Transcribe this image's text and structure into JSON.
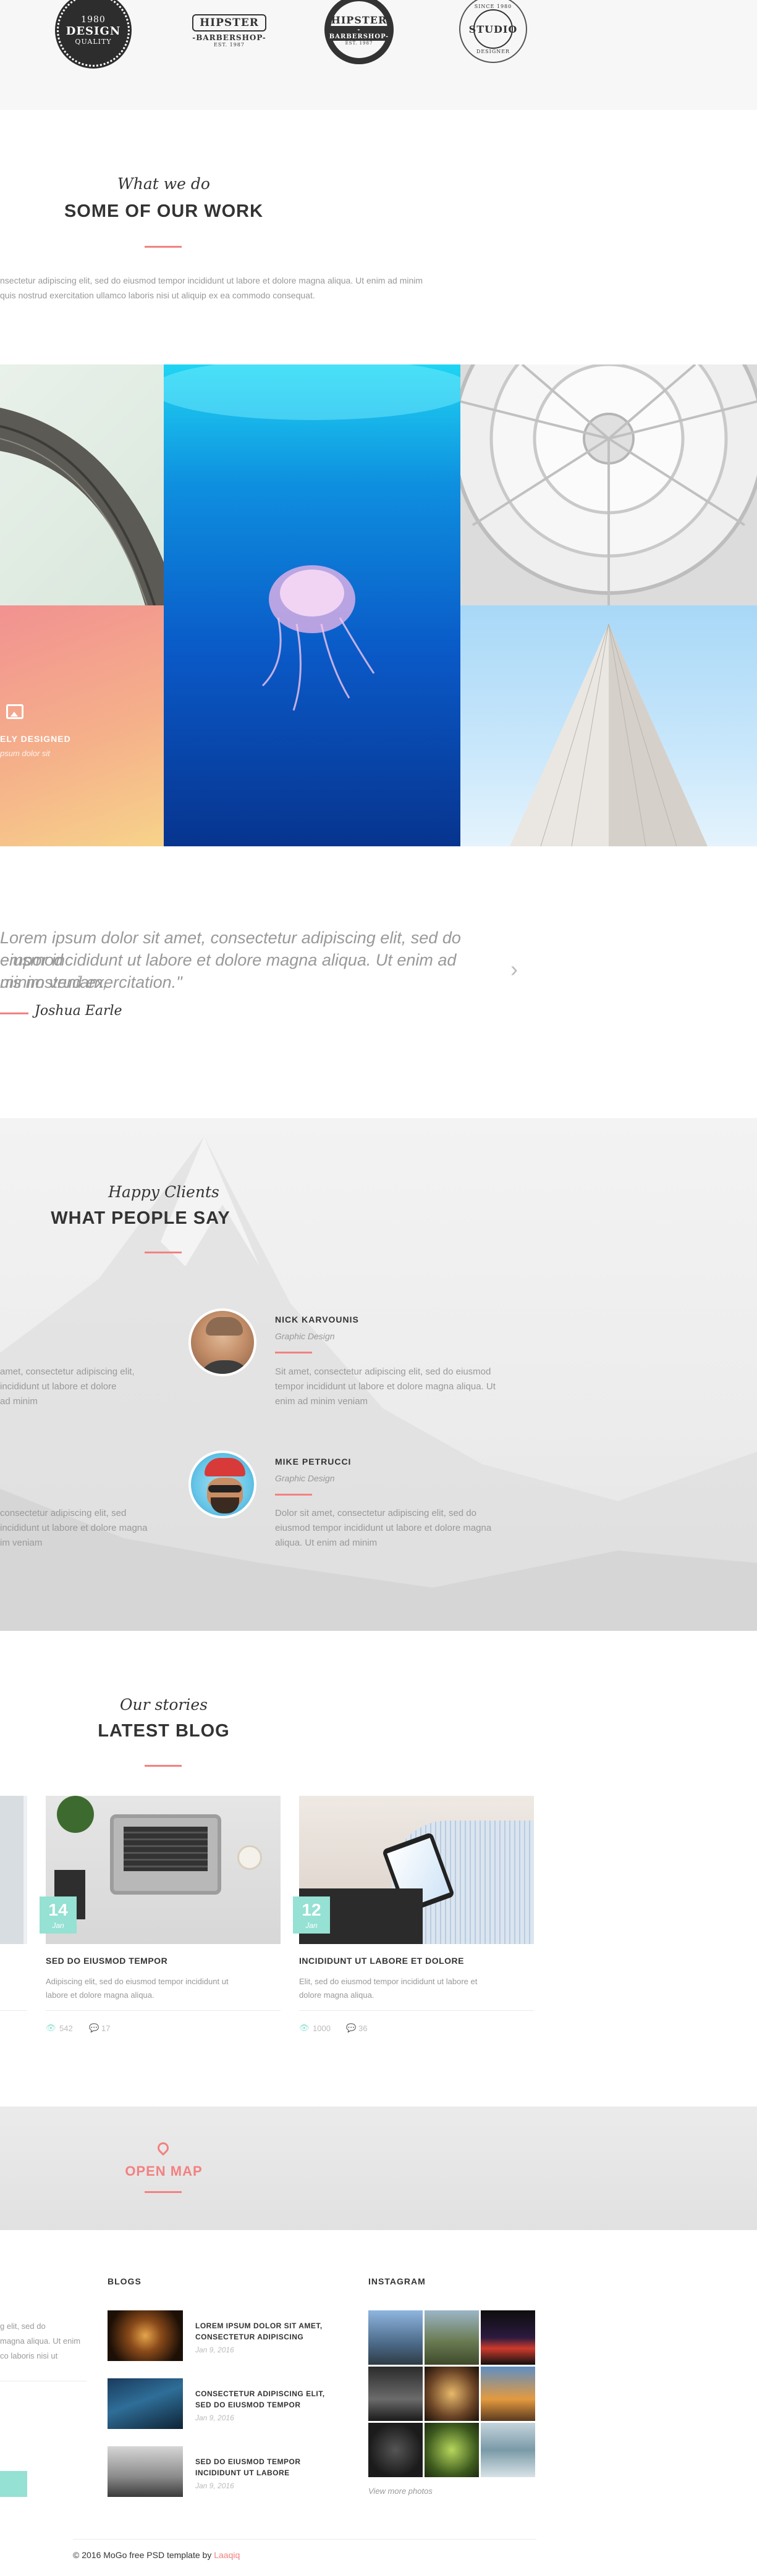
{
  "logos": [
    {
      "name": "design-quality-logo",
      "line1": "DESIGN",
      "line2": "QUALITY",
      "line3": "1980"
    },
    {
      "name": "hipster-barbershop-logo-1",
      "line1": "HIPSTER",
      "line2": "-BARBERSHOP-",
      "line3": "EST. 1987"
    },
    {
      "name": "hipster-barbershop-logo-2",
      "line1": "HIPSTER",
      "line2": "-BARBERSHOP-",
      "line3": "EST. 1987"
    },
    {
      "name": "studio-logo",
      "line1": "STUDIO",
      "line2": "SINCE 1980",
      "line3": "DESIGNER"
    }
  ],
  "work": {
    "script": "What we do",
    "title": "SOME OF OUR WORK",
    "text_line1": "nsectetur adipiscing elit, sed do eiusmod tempor incididunt ut labore et dolore magna aliqua. Ut enim ad minim",
    "text_line2": "quis nostrud exercitation ullamco laboris nisi ut aliquip ex ea commodo consequat.",
    "overlay_title": "ELY DESIGNED",
    "overlay_sub": "psum dolor sit"
  },
  "testimonial": {
    "line1": "Lorem ipsum dolor sit amet, consectetur adipiscing elit, sed do eiusmod",
    "line2": "empor incididunt ut labore et dolore magna aliqua. Ut enim ad minim veniam,",
    "line3": "uis nostrud exercitation.\"",
    "author": "Joshua Earle",
    "next_arrow": "›"
  },
  "clients": {
    "script": "Happy Clients",
    "title": "WHAT PEOPLE SAY",
    "left_col": [
      {
        "l1": "amet, consectetur adipiscing elit,",
        "l2": "incididunt ut labore et dolore",
        "l3": "ad minim"
      },
      {
        "l1": "consectetur adipiscing elit, sed",
        "l2": "incididunt ut labore et dolore magna",
        "l3": "im veniam"
      }
    ],
    "items": [
      {
        "name": "NICK KARVOUNIS",
        "role": "Graphic Design",
        "l1": "Sit amet, consectetur adipiscing elit, sed do eiusmod",
        "l2": "tempor incididunt ut labore et dolore magna aliqua. Ut",
        "l3": "enim ad minim veniam"
      },
      {
        "name": "MIKE PETRUCCI",
        "role": "Graphic Design",
        "l1": "Dolor sit amet, consectetur adipiscing elit, sed do",
        "l2": "eiusmod tempor incididunt ut labore et dolore magna",
        "l3": "aliqua. Ut enim ad minim"
      }
    ]
  },
  "blog": {
    "script": "Our stories",
    "title": "LATEST BLOG",
    "posts": [
      {
        "day": "14",
        "month": "Jan",
        "title": "SED DO EIUSMOD TEMPOR",
        "l1": "Adipiscing elit, sed do eiusmod tempor incididunt ut",
        "l2": "labore et dolore magna aliqua.",
        "views": "542",
        "comments": "17"
      },
      {
        "day": "12",
        "month": "Jan",
        "title": "INCIDIDUNT UT LABORE ET DOLORE",
        "l1": "Elit, sed do eiusmod tempor incididunt ut labore et",
        "l2": "dolore magna aliqua.",
        "views": "1000",
        "comments": "36"
      }
    ]
  },
  "map": {
    "label": "OPEN MAP"
  },
  "footer": {
    "left_l1": "g elit, sed do",
    "left_l2": "magna aliqua. Ut enim",
    "left_l3": "co laboris nisi ut",
    "blogs_heading": "BLOGS",
    "posts": [
      {
        "t1": "LOREM IPSUM DOLOR SIT AMET,",
        "t2": "CONSECTETUR ADIPISCING",
        "date": "Jan 9, 2016"
      },
      {
        "t1": "CONSECTETUR ADIPISCING ELIT,",
        "t2": "SED DO EIUSMOD TEMPOR",
        "date": "Jan 9, 2016"
      },
      {
        "t1": "SED DO EIUSMOD TEMPOR",
        "t2": "INCIDIDUNT UT LABORE",
        "date": "Jan 9, 2016"
      }
    ],
    "instagram_heading": "INSTAGRAM",
    "view_more": "View more photos",
    "copyright_prefix": "© 2016 MoGo free PSD template by ",
    "copyright_brand": "Laaqiq"
  },
  "colors": {
    "accent": "#f38181",
    "teal": "#95e1d3"
  }
}
